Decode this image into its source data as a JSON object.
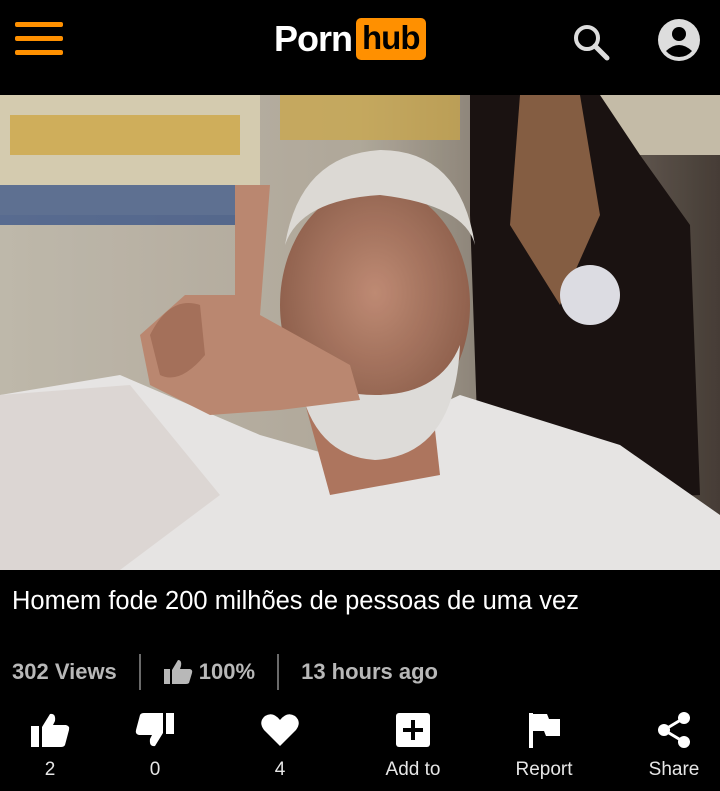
{
  "header": {
    "logo_word": "Porn",
    "logo_badge": "hub",
    "icons": [
      "menu-icon",
      "search-icon",
      "account-icon"
    ],
    "accent_color": "#ff9000"
  },
  "video": {
    "title": "Homem fode 200 milhões de pessoas de uma vez",
    "views": "302 Views",
    "rating": "100%",
    "uploaded": "13 hours ago"
  },
  "actions": [
    {
      "icon": "thumbs-up-icon",
      "label": "2"
    },
    {
      "icon": "thumbs-down-icon",
      "label": "0"
    },
    {
      "icon": "heart-icon",
      "label": "4"
    },
    {
      "icon": "add-icon",
      "label": "Add to"
    },
    {
      "icon": "flag-icon",
      "label": "Report"
    },
    {
      "icon": "share-icon",
      "label": "Share"
    }
  ]
}
